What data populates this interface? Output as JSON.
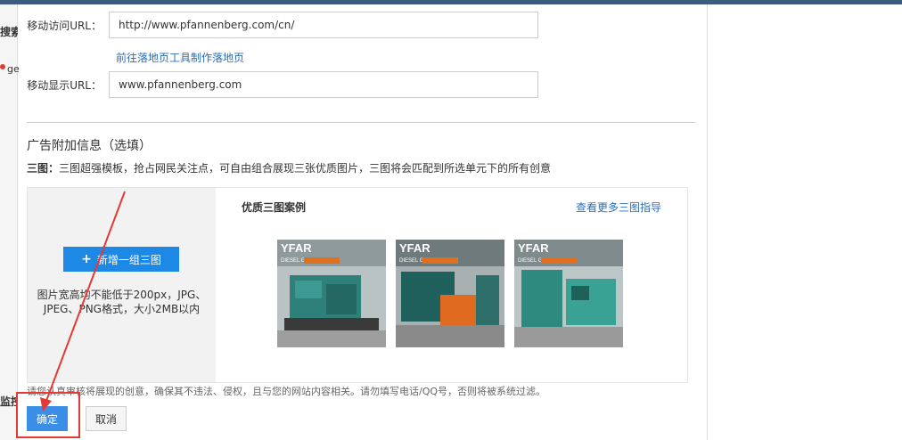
{
  "left_panel": {
    "fragment_search": "搜索",
    "fragment_ge": "ge",
    "fragment_monitor": "监控"
  },
  "form": {
    "mobile_url_label": "移动访问URL：",
    "mobile_url_value": "http://www.pfannenberg.com/cn/",
    "landing_link": "前往落地页工具制作落地页",
    "display_url_label": "移动显示URL：",
    "display_url_value": "www.pfannenberg.com"
  },
  "extension": {
    "section_title": "广告附加信息（选填）",
    "three_image_label": "三图：",
    "three_image_desc": "三图超强模板，抢占网民关注点，可自由组合展现三张优质图片，三图将会匹配到所选单元下的所有创意",
    "add_button_icon": "plus-icon",
    "add_button_label": "新增一组三图",
    "hint": "图片宽高均不能低于200px，JPG、JPEG、PNG格式，大小2MB以内",
    "examples_title": "优质三图案例",
    "more_link": "查看更多三图指导",
    "thumbnails": [
      {
        "brand": "YFAR",
        "caption": "DIESEL GENERATORS",
        "accent": "#e07020"
      },
      {
        "brand": "YFAR",
        "caption": "DIESEL GENERATORS",
        "accent": "#e07020"
      },
      {
        "brand": "YFAR",
        "caption": "DIESEL GENERATORS",
        "accent": "#e07020"
      }
    ]
  },
  "footer": {
    "disclaimer": "请您认真审核将展现的创意，确保其不违法、侵权，且与您的网站内容相关。请勿填写电话/QQ号，否则将被系统过滤。",
    "confirm_label": "确定",
    "cancel_label": "取消"
  },
  "colors": {
    "primary": "#1e88e5",
    "link": "#2a6ebb",
    "annotation": "#e53935"
  }
}
